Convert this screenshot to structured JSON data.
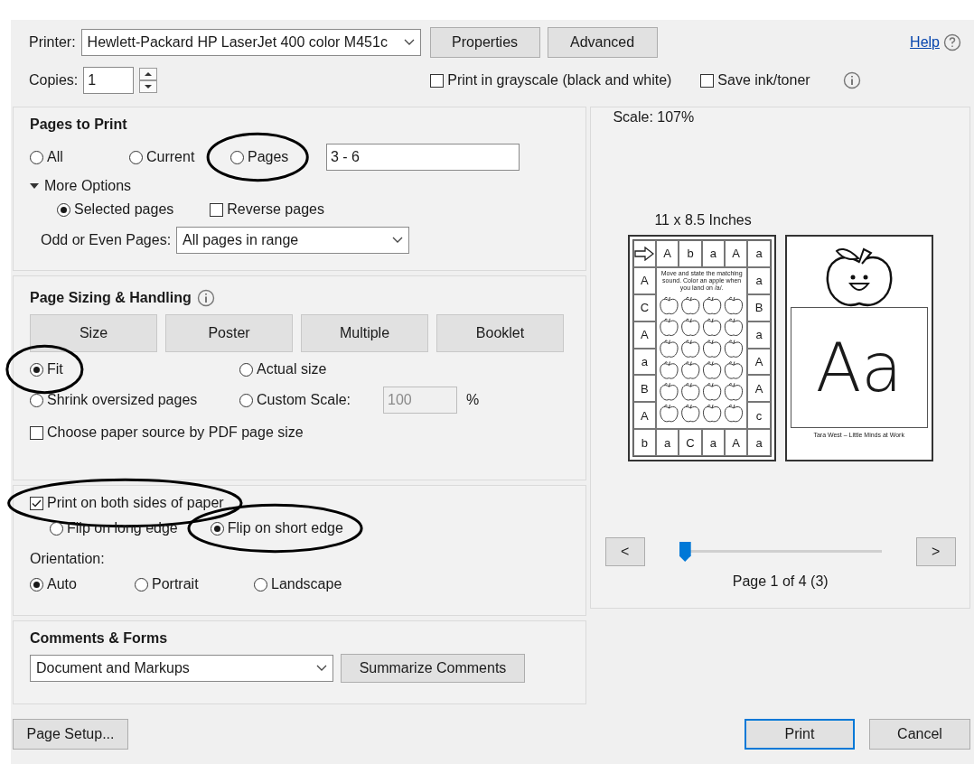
{
  "printer": {
    "label": "Printer:",
    "value": "Hewlett-Packard HP LaserJet 400 color M451c"
  },
  "top_buttons": [
    "Properties",
    "Advanced"
  ],
  "help": {
    "link": "Help"
  },
  "copies": {
    "label": "Copies:",
    "value": "1"
  },
  "print_options": [
    {
      "label": "Print in grayscale (black and white)",
      "checked": false
    },
    {
      "label": "Save ink/toner",
      "checked": false
    }
  ],
  "pages_to_print": {
    "title": "Pages to Print",
    "choices": [
      {
        "label": "All",
        "selected": false,
        "circled": false
      },
      {
        "label": "Current",
        "selected": false,
        "circled": false
      },
      {
        "label": "Pages",
        "selected": false,
        "circled": true
      }
    ],
    "pages_value": "3 - 6",
    "more_options": {
      "label": "More Options",
      "expanded": true
    },
    "subset": [
      {
        "kind": "radio",
        "label": "Selected pages",
        "on": true
      },
      {
        "kind": "checkbox",
        "label": "Reverse pages",
        "on": false
      }
    ],
    "odd_even": {
      "label": "Odd or Even Pages:",
      "value": "All pages in range"
    }
  },
  "page_sizing": {
    "title": "Page Sizing & Handling",
    "tabs": [
      "Size",
      "Poster",
      "Multiple",
      "Booklet"
    ],
    "fit_options": [
      {
        "label": "Fit",
        "selected": true,
        "circled": true
      },
      {
        "label": "Actual size",
        "selected": false,
        "circled": false
      },
      {
        "label": "Shrink oversized pages",
        "selected": false,
        "circled": false
      },
      {
        "label": "Custom Scale:",
        "selected": false,
        "circled": false
      }
    ],
    "custom_scale": {
      "value": "100",
      "unit": "%",
      "disabled": true
    },
    "paper_source": {
      "label": "Choose paper source by PDF page size",
      "checked": false
    }
  },
  "duplex": {
    "label": "Print on both sides of paper",
    "checked": true,
    "circled": true,
    "flips": [
      {
        "label": "Flip on long edge",
        "selected": false,
        "circled": false
      },
      {
        "label": "Flip on short edge",
        "selected": true,
        "circled": true
      }
    ]
  },
  "orientation": {
    "label": "Orientation:",
    "choices": [
      {
        "label": "Auto",
        "selected": true
      },
      {
        "label": "Portrait",
        "selected": false
      },
      {
        "label": "Landscape",
        "selected": false
      }
    ]
  },
  "comments_forms": {
    "title": "Comments & Forms",
    "value": "Document and Markups",
    "button": "Summarize Comments"
  },
  "preview": {
    "scale": "Scale: 107%",
    "paper_size": "11 x 8.5 Inches",
    "prev": "<",
    "next": ">",
    "level": 0,
    "page_label": "Page 1 of 4 (3)",
    "worksheet": {
      "top_row": [
        "A",
        "b",
        "a",
        "A",
        "a"
      ],
      "left_column": [
        "A",
        "C",
        "A",
        "a",
        "B",
        "A"
      ],
      "right_column": [
        "a",
        "B",
        "a",
        "A",
        "A",
        "c"
      ],
      "bottom_row": [
        "b",
        "a",
        "C",
        "a",
        "A",
        "a"
      ],
      "instructions": "Move and state the matching sound. Color an apple when you land on /a/."
    },
    "card": {
      "letters": "Aa",
      "credit": "Tara West – Little Minds at Work"
    }
  },
  "bottom_buttons": {
    "page_setup": "Page Setup...",
    "print": "Print",
    "cancel": "Cancel"
  }
}
